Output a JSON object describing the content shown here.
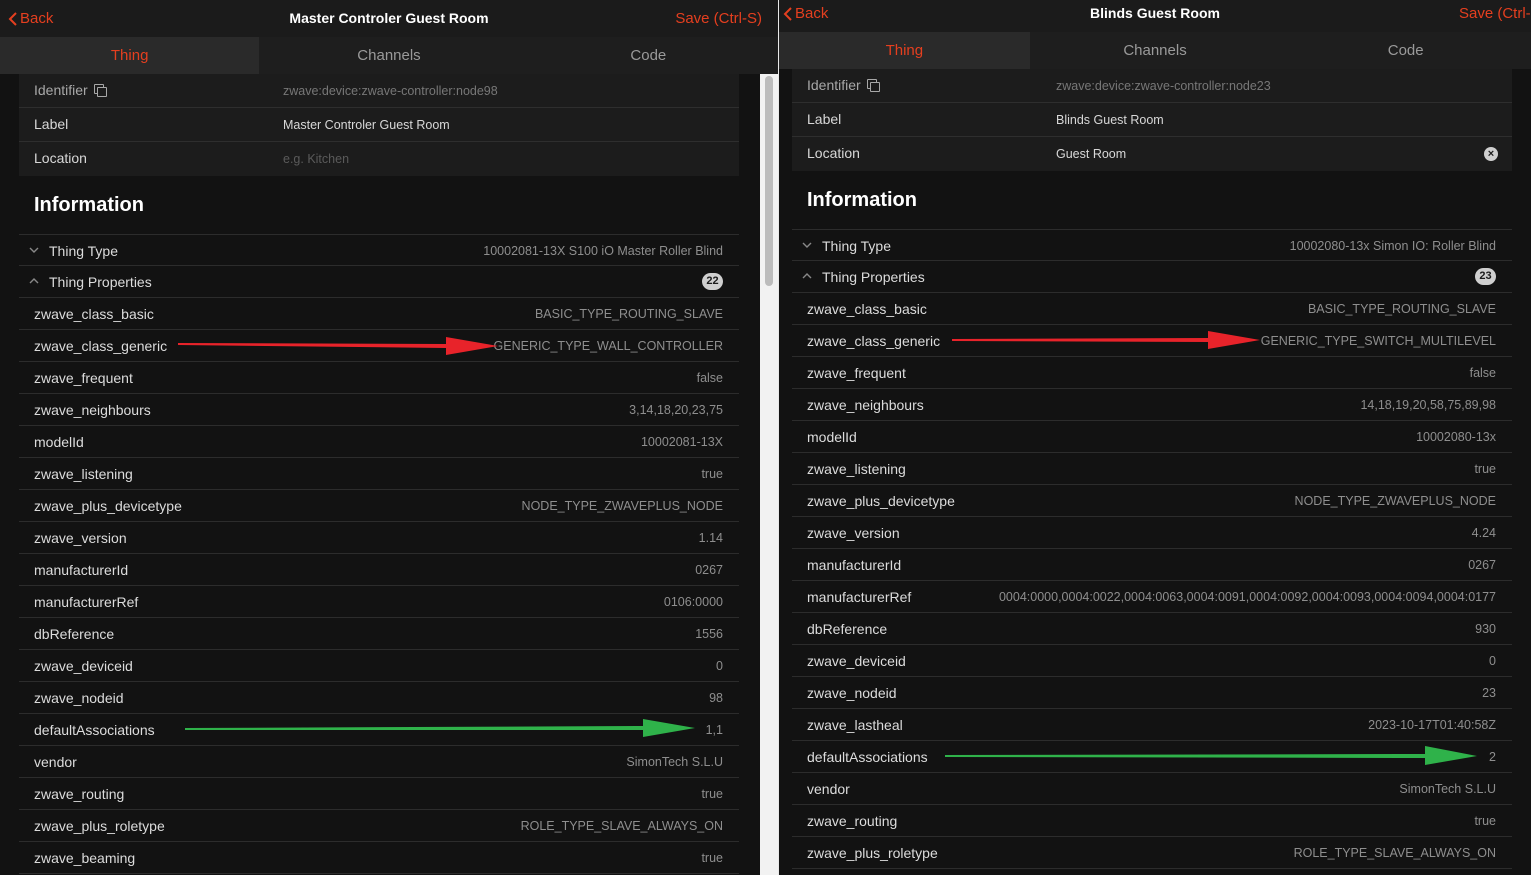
{
  "left": {
    "back_label": "Back",
    "title": "Master Controler Guest Room",
    "save_label": "Save (Ctrl-S)",
    "tabs": [
      {
        "label": "Thing"
      },
      {
        "label": "Channels"
      },
      {
        "label": "Code"
      }
    ],
    "identifier_label": "Identifier",
    "identifier_value": "zwave:device:zwave-controller:node98",
    "label_label": "Label",
    "label_value": "Master Controler Guest Room",
    "location_label": "Location",
    "location_placeholder": "e.g. Kitchen",
    "section_title": "Information",
    "thing_type_label": "Thing Type",
    "thing_type_value": "10002081-13X S100 iO Master Roller Blind",
    "thing_props_label": "Thing Properties",
    "thing_props_count": "22",
    "properties": [
      {
        "key": "zwave_class_basic",
        "value": "BASIC_TYPE_ROUTING_SLAVE"
      },
      {
        "key": "zwave_class_generic",
        "value": "GENERIC_TYPE_WALL_CONTROLLER"
      },
      {
        "key": "zwave_frequent",
        "value": "false"
      },
      {
        "key": "zwave_neighbours",
        "value": "3,14,18,20,23,75"
      },
      {
        "key": "modelId",
        "value": "10002081-13X"
      },
      {
        "key": "zwave_listening",
        "value": "true"
      },
      {
        "key": "zwave_plus_devicetype",
        "value": "NODE_TYPE_ZWAVEPLUS_NODE"
      },
      {
        "key": "zwave_version",
        "value": "1.14"
      },
      {
        "key": "manufacturerId",
        "value": "0267"
      },
      {
        "key": "manufacturerRef",
        "value": "0106:0000"
      },
      {
        "key": "dbReference",
        "value": "1556"
      },
      {
        "key": "zwave_deviceid",
        "value": "0"
      },
      {
        "key": "zwave_nodeid",
        "value": "98"
      },
      {
        "key": "defaultAssociations",
        "value": "1,1"
      },
      {
        "key": "vendor",
        "value": "SimonTech S.L.U"
      },
      {
        "key": "zwave_routing",
        "value": "true"
      },
      {
        "key": "zwave_plus_roletype",
        "value": "ROLE_TYPE_SLAVE_ALWAYS_ON"
      },
      {
        "key": "zwave_beaming",
        "value": "true"
      }
    ]
  },
  "right": {
    "back_label": "Back",
    "title": "Blinds Guest Room",
    "save_label": "Save (Ctrl-S",
    "tabs": [
      {
        "label": "Thing"
      },
      {
        "label": "Channels"
      },
      {
        "label": "Code"
      }
    ],
    "identifier_label": "Identifier",
    "identifier_value": "zwave:device:zwave-controller:node23",
    "label_label": "Label",
    "label_value": "Blinds Guest Room",
    "location_label": "Location",
    "location_value": "Guest Room",
    "section_title": "Information",
    "thing_type_label": "Thing Type",
    "thing_type_value": "10002080-13x Simon IO: Roller Blind",
    "thing_props_label": "Thing Properties",
    "thing_props_count": "23",
    "properties": [
      {
        "key": "zwave_class_basic",
        "value": "BASIC_TYPE_ROUTING_SLAVE"
      },
      {
        "key": "zwave_class_generic",
        "value": "GENERIC_TYPE_SWITCH_MULTILEVEL"
      },
      {
        "key": "zwave_frequent",
        "value": "false"
      },
      {
        "key": "zwave_neighbours",
        "value": "14,18,19,20,58,75,89,98"
      },
      {
        "key": "modelId",
        "value": "10002080-13x"
      },
      {
        "key": "zwave_listening",
        "value": "true"
      },
      {
        "key": "zwave_plus_devicetype",
        "value": "NODE_TYPE_ZWAVEPLUS_NODE"
      },
      {
        "key": "zwave_version",
        "value": "4.24"
      },
      {
        "key": "manufacturerId",
        "value": "0267"
      },
      {
        "key": "manufacturerRef",
        "value": "0004:0000,0004:0022,0004:0063,0004:0091,0004:0092,0004:0093,0004:0094,0004:0177"
      },
      {
        "key": "dbReference",
        "value": "930"
      },
      {
        "key": "zwave_deviceid",
        "value": "0"
      },
      {
        "key": "zwave_nodeid",
        "value": "23"
      },
      {
        "key": "zwave_lastheal",
        "value": "2023-10-17T01:40:58Z"
      },
      {
        "key": "defaultAssociations",
        "value": "2"
      },
      {
        "key": "vendor",
        "value": "SimonTech S.L.U"
      },
      {
        "key": "zwave_routing",
        "value": "true"
      },
      {
        "key": "zwave_plus_roletype",
        "value": "ROLE_TYPE_SLAVE_ALWAYS_ON"
      }
    ]
  },
  "colors": {
    "accent": "#e53f1f",
    "arrow_red": "#e8232a",
    "arrow_green": "#2fb24a"
  }
}
